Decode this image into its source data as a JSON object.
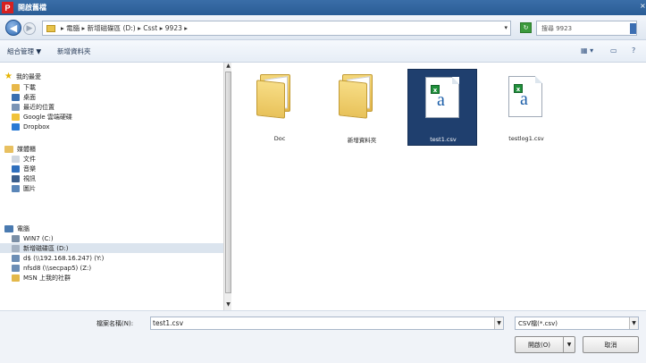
{
  "window": {
    "title": "開啟舊檔",
    "app_icon_letter": "P"
  },
  "address": {
    "path": "▸ 電腦 ▸ 新增磁碟區 (D:) ▸ Csst ▸ 9923 ▸",
    "search_placeholder": "搜尋 9923"
  },
  "toolbar": {
    "organize": "組合管理 ▼",
    "new_folder": "新增資料夾"
  },
  "nav": {
    "favorites_header": "我的最愛",
    "favorites": [
      "下載",
      "桌面",
      "最近的位置",
      "Google 雲端硬碟",
      "Dropbox"
    ],
    "libraries_header": "媒體櫃",
    "libraries": [
      "文件",
      "音樂",
      "視訊",
      "圖片"
    ],
    "computer_header": "電腦",
    "computer": [
      "WIN7 (C:)",
      "新增磁碟區 (D:)",
      "d$ (\\\\192.168.16.247) (Y:)",
      "nfsd8 (\\\\secpap5) (Z:)",
      "MSN 上我的社群"
    ]
  },
  "files": [
    {
      "name": "Doc",
      "kind": "folder"
    },
    {
      "name": "新增資料夾",
      "kind": "folder"
    },
    {
      "name": "test1.csv",
      "kind": "csv",
      "selected": true
    },
    {
      "name": "testlog1.csv",
      "kind": "csv"
    }
  ],
  "bottom": {
    "filename_label": "檔案名稱(N):",
    "filename_value": "test1.csv",
    "filetype_value": "CSV檔(*.csv)",
    "open_label": "開啟(O)",
    "cancel_label": "取消"
  },
  "colors": {
    "titlebar": "#2a5c95",
    "selection": "#1f3f6e",
    "excel_green": "#1f8f3a"
  }
}
